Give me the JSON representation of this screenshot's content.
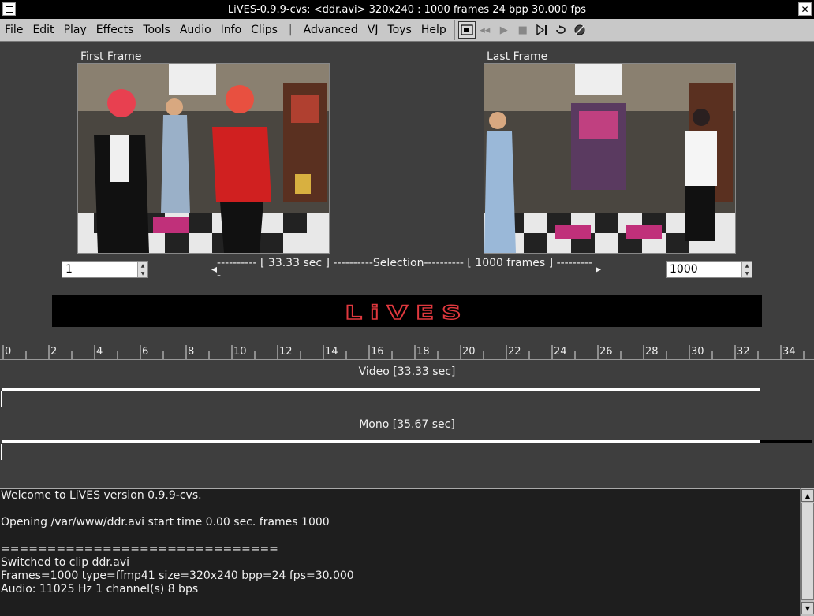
{
  "window": {
    "title": "LiVES-0.9.9-cvs: <ddr.avi> 320x240 : 1000 frames 24 bpp 30.000 fps"
  },
  "menu": {
    "items": [
      "File",
      "Edit",
      "Play",
      "Effects",
      "Tools",
      "Audio",
      "Info",
      "Clips"
    ],
    "separator": "|",
    "items2": [
      "Advanced",
      "VJ",
      "Toys",
      "Help"
    ]
  },
  "toolbar": {
    "icons": [
      "sepwin-icon",
      "rewind-icon",
      "play-icon",
      "stop-icon",
      "play-selection-icon",
      "loop-icon",
      "mute-icon"
    ]
  },
  "frames": {
    "first_label": "First Frame",
    "last_label": "Last Frame",
    "start_value": "1",
    "end_value": "1000"
  },
  "selection": {
    "text": "---------- [ 33.33 sec ] ----------Selection---------- [ 1000 frames ] ----------"
  },
  "logo_text": "LiVES",
  "ruler": {
    "ticks": [
      "0",
      "2",
      "4",
      "6",
      "8",
      "10",
      "12",
      "14",
      "16",
      "18",
      "20",
      "22",
      "24",
      "26",
      "28",
      "30",
      "32",
      "34"
    ]
  },
  "tracks": {
    "video_label": "Video [33.33 sec]",
    "audio_label": "Mono [35.67 sec]"
  },
  "console": {
    "lines": [
      "Welcome to LiVES version 0.9.9-cvs.",
      "",
      "Opening /var/www/ddr.avi start time 0.00 sec. frames 1000",
      "",
      "==============================",
      "Switched to clip ddr.avi",
      "Frames=1000 type=ffmp41 size=320x240 bpp=24 fps=30.000",
      "Audio: 11025 Hz 1 channel(s) 8 bps"
    ]
  },
  "colors": {
    "logo_red": "#e0383e",
    "track_bar": "#ffffff",
    "background": "#3e3e3e"
  }
}
